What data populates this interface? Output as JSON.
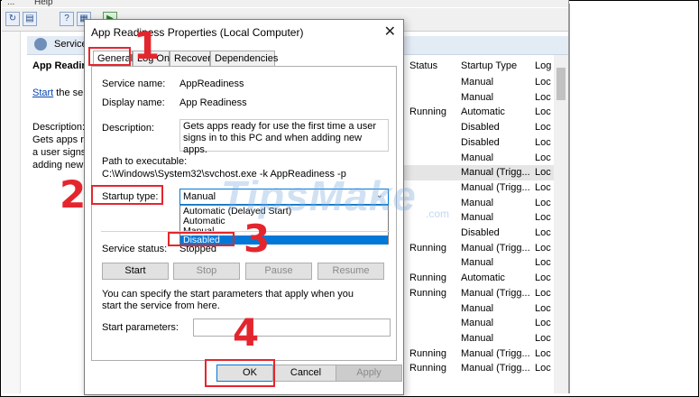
{
  "window": {
    "menu": [
      "...",
      "Help"
    ],
    "header_text": "Services",
    "selected_service_title": "App Readiness",
    "start_text": "Start",
    "start_suffix": " the service",
    "description_label": "Description:",
    "description_lines": [
      "Gets apps rea...",
      "a user signs in...",
      "adding new a..."
    ]
  },
  "list": {
    "columns": [
      "Status",
      "Startup Type",
      "Log"
    ],
    "rows": [
      {
        "status": "",
        "startup": "Manual",
        "log": "Loc"
      },
      {
        "status": "",
        "startup": "Manual",
        "log": "Loc"
      },
      {
        "status": "Running",
        "startup": "Automatic",
        "log": "Loc"
      },
      {
        "status": "",
        "startup": "Disabled",
        "log": "Loc"
      },
      {
        "status": "",
        "startup": "Disabled",
        "log": "Loc"
      },
      {
        "status": "",
        "startup": "Manual",
        "log": "Loc"
      },
      {
        "status": "",
        "startup": "Manual (Trigg...",
        "log": "Loc"
      },
      {
        "status": "",
        "startup": "Manual (Trigg...",
        "log": "Loc"
      },
      {
        "status": "",
        "startup": "Manual",
        "log": "Loc"
      },
      {
        "status": "",
        "startup": "Manual",
        "log": "Loc"
      },
      {
        "status": "",
        "startup": "Disabled",
        "log": "Loc"
      },
      {
        "status": "Running",
        "startup": "Manual (Trigg...",
        "log": "Loc"
      },
      {
        "status": "",
        "startup": "Manual",
        "log": "Loc"
      },
      {
        "status": "Running",
        "startup": "Automatic",
        "log": "Loc"
      },
      {
        "status": "Running",
        "startup": "Manual (Trigg...",
        "log": "Loc"
      },
      {
        "status": "",
        "startup": "Manual",
        "log": "Loc"
      },
      {
        "status": "",
        "startup": "Manual",
        "log": "Loc"
      },
      {
        "status": "",
        "startup": "Manual",
        "log": "Loc"
      },
      {
        "status": "Running",
        "startup": "Manual (Trigg...",
        "log": "Loc"
      },
      {
        "status": "Running",
        "startup": "Manual (Trigg...",
        "log": "Loc"
      }
    ]
  },
  "dialog": {
    "title": "App Readiness Properties (Local Computer)",
    "close_glyph": "✕",
    "tabs": [
      "General",
      "Log On",
      "Recovery",
      "Dependencies"
    ],
    "service_name_label": "Service name:",
    "service_name": "AppReadiness",
    "display_name_label": "Display name:",
    "display_name": "App Readiness",
    "description_label": "Description:",
    "description": "Gets apps ready for use the first time a user signs in to this PC and when adding new apps.",
    "path_label": "Path to executable:",
    "path": "C:\\Windows\\System32\\svchost.exe -k AppReadiness -p",
    "startup_type_label": "Startup type:",
    "startup_type_value": "Manual",
    "startup_options": [
      "Automatic (Delayed Start)",
      "Automatic",
      "Manual",
      "Disabled"
    ],
    "service_status_label": "Service status:",
    "service_status": "Stopped",
    "buttons": {
      "start": "Start",
      "stop": "Stop",
      "pause": "Pause",
      "resume": "Resume"
    },
    "start_params_text": "You can specify the start parameters that apply when you start the service from here.",
    "start_params_label": "Start parameters:",
    "start_params_value": "",
    "ok": "OK",
    "cancel": "Cancel",
    "apply": "Apply"
  },
  "annotations": {
    "step1": "1",
    "step2": "2",
    "step3": "3",
    "step4": "4",
    "accent_color": "#e3262e"
  },
  "watermark": {
    "text": "TipsMake",
    "suffix": ".com"
  }
}
